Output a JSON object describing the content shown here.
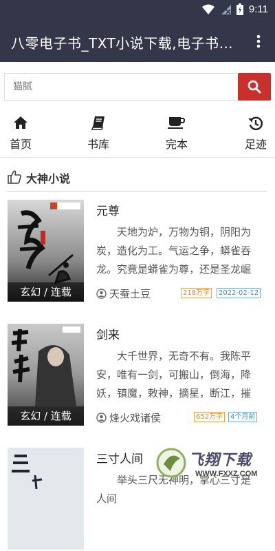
{
  "status": {
    "time": "9:11"
  },
  "appbar": {
    "title": "八零电子书_TXT小说下载,电子书下载"
  },
  "search": {
    "placeholder": "猫腻"
  },
  "nav": [
    {
      "label": "首页",
      "icon": "home-icon"
    },
    {
      "label": "书库",
      "icon": "book-icon"
    },
    {
      "label": "完本",
      "icon": "cup-icon"
    },
    {
      "label": "足迹",
      "icon": "history-icon"
    }
  ],
  "section": {
    "title": "大神小说",
    "icon": "thumbs-up-icon"
  },
  "books": [
    {
      "title": "元尊",
      "desc": "天地为炉，万物为铜，阴阳为炭，造化为工。气运之争，蟒雀吞龙。究竟是蟒雀为尊，还是圣龙崛起",
      "author": "天蚕土豆",
      "words": "218万字",
      "date": "2022-02-12",
      "tag": "玄幻 / 连载"
    },
    {
      "title": "剑来",
      "desc": "大千世界，无奇不有。我陈平安，唯有一剑，可搬山，倒海，降妖，镇魔，敕神，摘星，断江，摧城",
      "author": "烽火戏诸侯",
      "words": "652万字",
      "date": "4个月前",
      "tag": "玄幻 / 连载"
    },
    {
      "title": "三寸人间",
      "desc": "举头三尺无神明，掌心三寸是人间",
      "author": "",
      "words": "",
      "date": "",
      "tag": ""
    }
  ],
  "watermark": {
    "text": "飞翔下载",
    "url": "WWW.FXXZ.COM"
  },
  "colors": {
    "bar": "#34374a",
    "search_btn": "#c9302c"
  }
}
